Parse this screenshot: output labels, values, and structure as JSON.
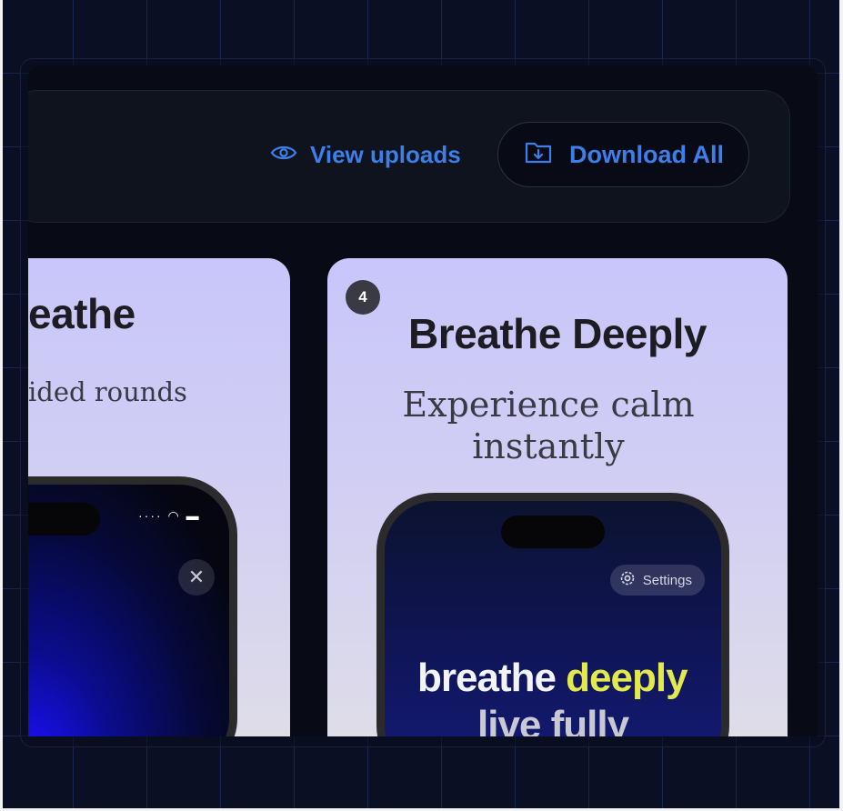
{
  "toolbar": {
    "view_uploads_label": "View uploads",
    "download_all_label": "Download All",
    "view_icon": "eye-icon",
    "download_icon": "folder-download-icon"
  },
  "cards": [
    {
      "headline": "eathe",
      "subtitle": "ided rounds",
      "close_icon": "close-icon"
    },
    {
      "badge": "4",
      "headline": "Breathe Deeply",
      "subtitle_line1": "Experience calm",
      "subtitle_line2": "instantly",
      "settings_label": "Settings",
      "screen_text_white": "breathe ",
      "screen_text_accent": "deeply",
      "screen_text_line2": "live fully"
    }
  ],
  "colors": {
    "accent_blue": "#3d7ee8",
    "card_lavender": "#c8c6fa",
    "screen_yellow": "#e2e94b",
    "background": "#0a0f24"
  }
}
